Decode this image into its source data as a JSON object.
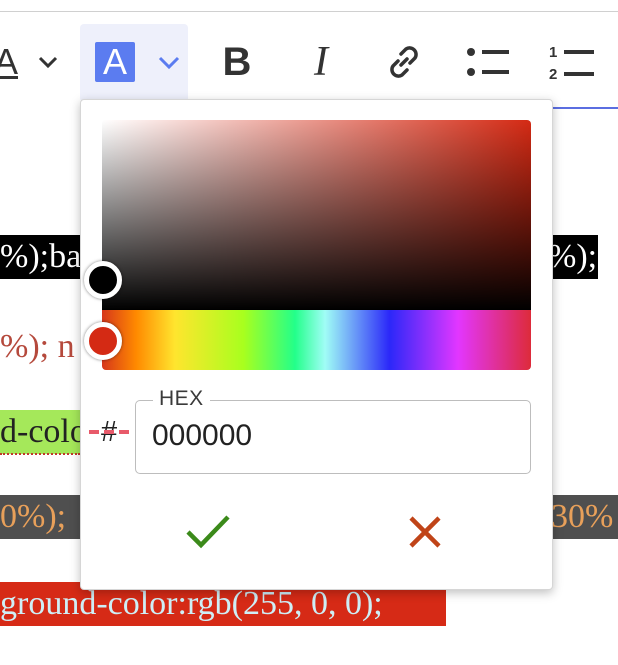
{
  "editor": {
    "line1_left": "%);ba",
    "line1_right": "%);",
    "line2_left": "%); n",
    "line3_left": "d-colo",
    "line4_left": "0%);",
    "line4_right": "30%",
    "line5": "ground-color:rgb(255, 0, 0);"
  },
  "toolbar": {
    "text_color_glyph": "A",
    "font_color_glyph": "A",
    "font_color_swatch": "#5b7cf0"
  },
  "color_picker": {
    "hue_color": "#d42a14",
    "hex_label": "HEX",
    "hash": "#",
    "hex_value": "000000",
    "confirm_color": "#3b8a1a",
    "cancel_color": "#c04418"
  }
}
